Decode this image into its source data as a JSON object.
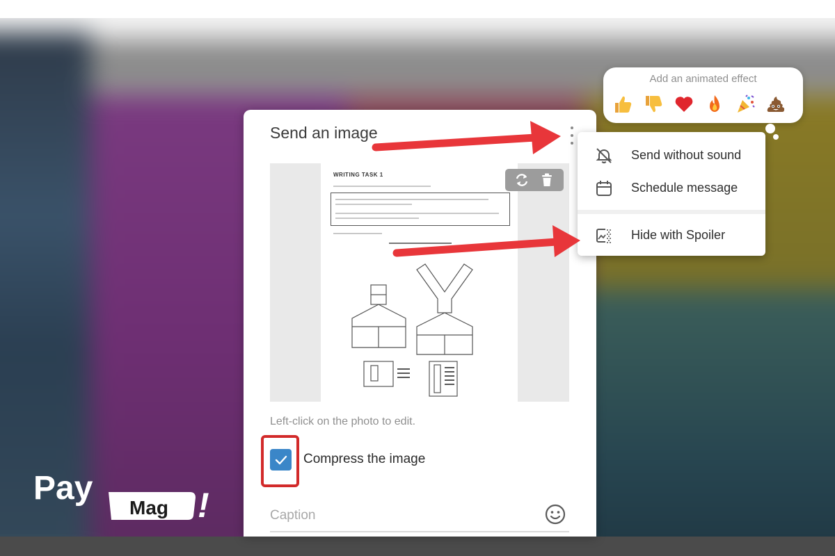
{
  "dialog": {
    "title": "Send an image",
    "edit_hint": "Left-click on the photo to edit.",
    "compress_label": "Compress the image",
    "compress_checked": true,
    "caption_placeholder": "Caption"
  },
  "document_preview": {
    "heading": "WRITING TASK 1"
  },
  "menu": {
    "items": [
      {
        "label": "Send without sound",
        "icon": "muted-bell-icon"
      },
      {
        "label": "Schedule message",
        "icon": "calendar-icon"
      },
      {
        "label": "Hide with Spoiler",
        "icon": "spoiler-image-icon"
      }
    ]
  },
  "effects": {
    "title": "Add an animated effect",
    "emojis": [
      {
        "name": "thumbs-up",
        "glyph": "👍"
      },
      {
        "name": "thumbs-down",
        "glyph": "👎"
      },
      {
        "name": "heart",
        "glyph": "❤"
      },
      {
        "name": "fire",
        "glyph": "🔥"
      },
      {
        "name": "party-popper",
        "glyph": "🎉"
      },
      {
        "name": "poop",
        "glyph": "💩"
      }
    ]
  },
  "logo": {
    "word1": "Pay",
    "word2": "Mag",
    "mark": "!"
  },
  "colors": {
    "accent_blue": "#3a86c8",
    "highlight_red": "#d22a2a",
    "arrow_red": "#e8363a"
  }
}
